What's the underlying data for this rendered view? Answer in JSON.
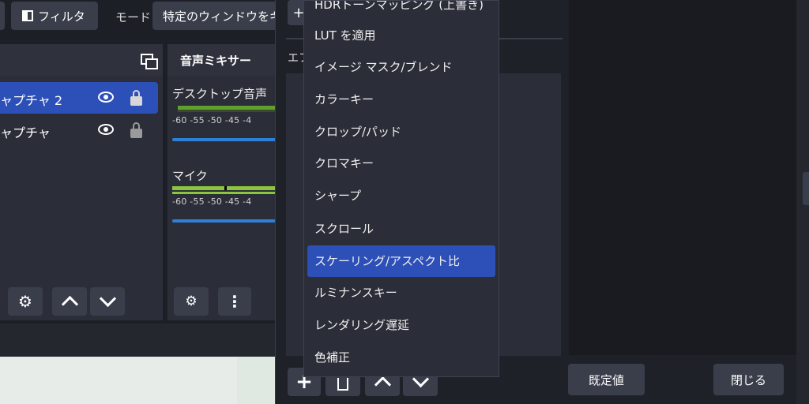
{
  "toolbar": {
    "filter_label": "フィルタ",
    "mode_label": "モード",
    "mode_value": "特定のウィンドウをキ"
  },
  "sources": {
    "items": [
      {
        "label": "ャプチャ 2"
      },
      {
        "label": "ャプチャ"
      }
    ]
  },
  "audio_mixer": {
    "title": "音声ミキサー",
    "channels": [
      {
        "name": "デスクトップ音声",
        "ticks": "-60  -55  -50  -45  -4"
      },
      {
        "name": "マイク",
        "ticks": "-60  -55  -50  -45  -4"
      }
    ]
  },
  "filters_dialog": {
    "effects_label": "エフ",
    "default_button": "既定値",
    "close_button": "閉じる"
  },
  "context_menu": {
    "items": [
      "HDRトーンマッピング (上書き)",
      "LUT を適用",
      "イメージ マスク/ブレンド",
      "カラーキー",
      "クロップ/パッド",
      "クロマキー",
      "シャープ",
      "スクロール",
      "スケーリング/アスペクト比",
      "ルミナンスキー",
      "レンダリング遅延",
      "色補正"
    ],
    "selected_index": 8
  },
  "colors": {
    "accent": "#2d4fb8",
    "meter_green": "#5fa02c",
    "slider_blue": "#2f7fd6"
  }
}
